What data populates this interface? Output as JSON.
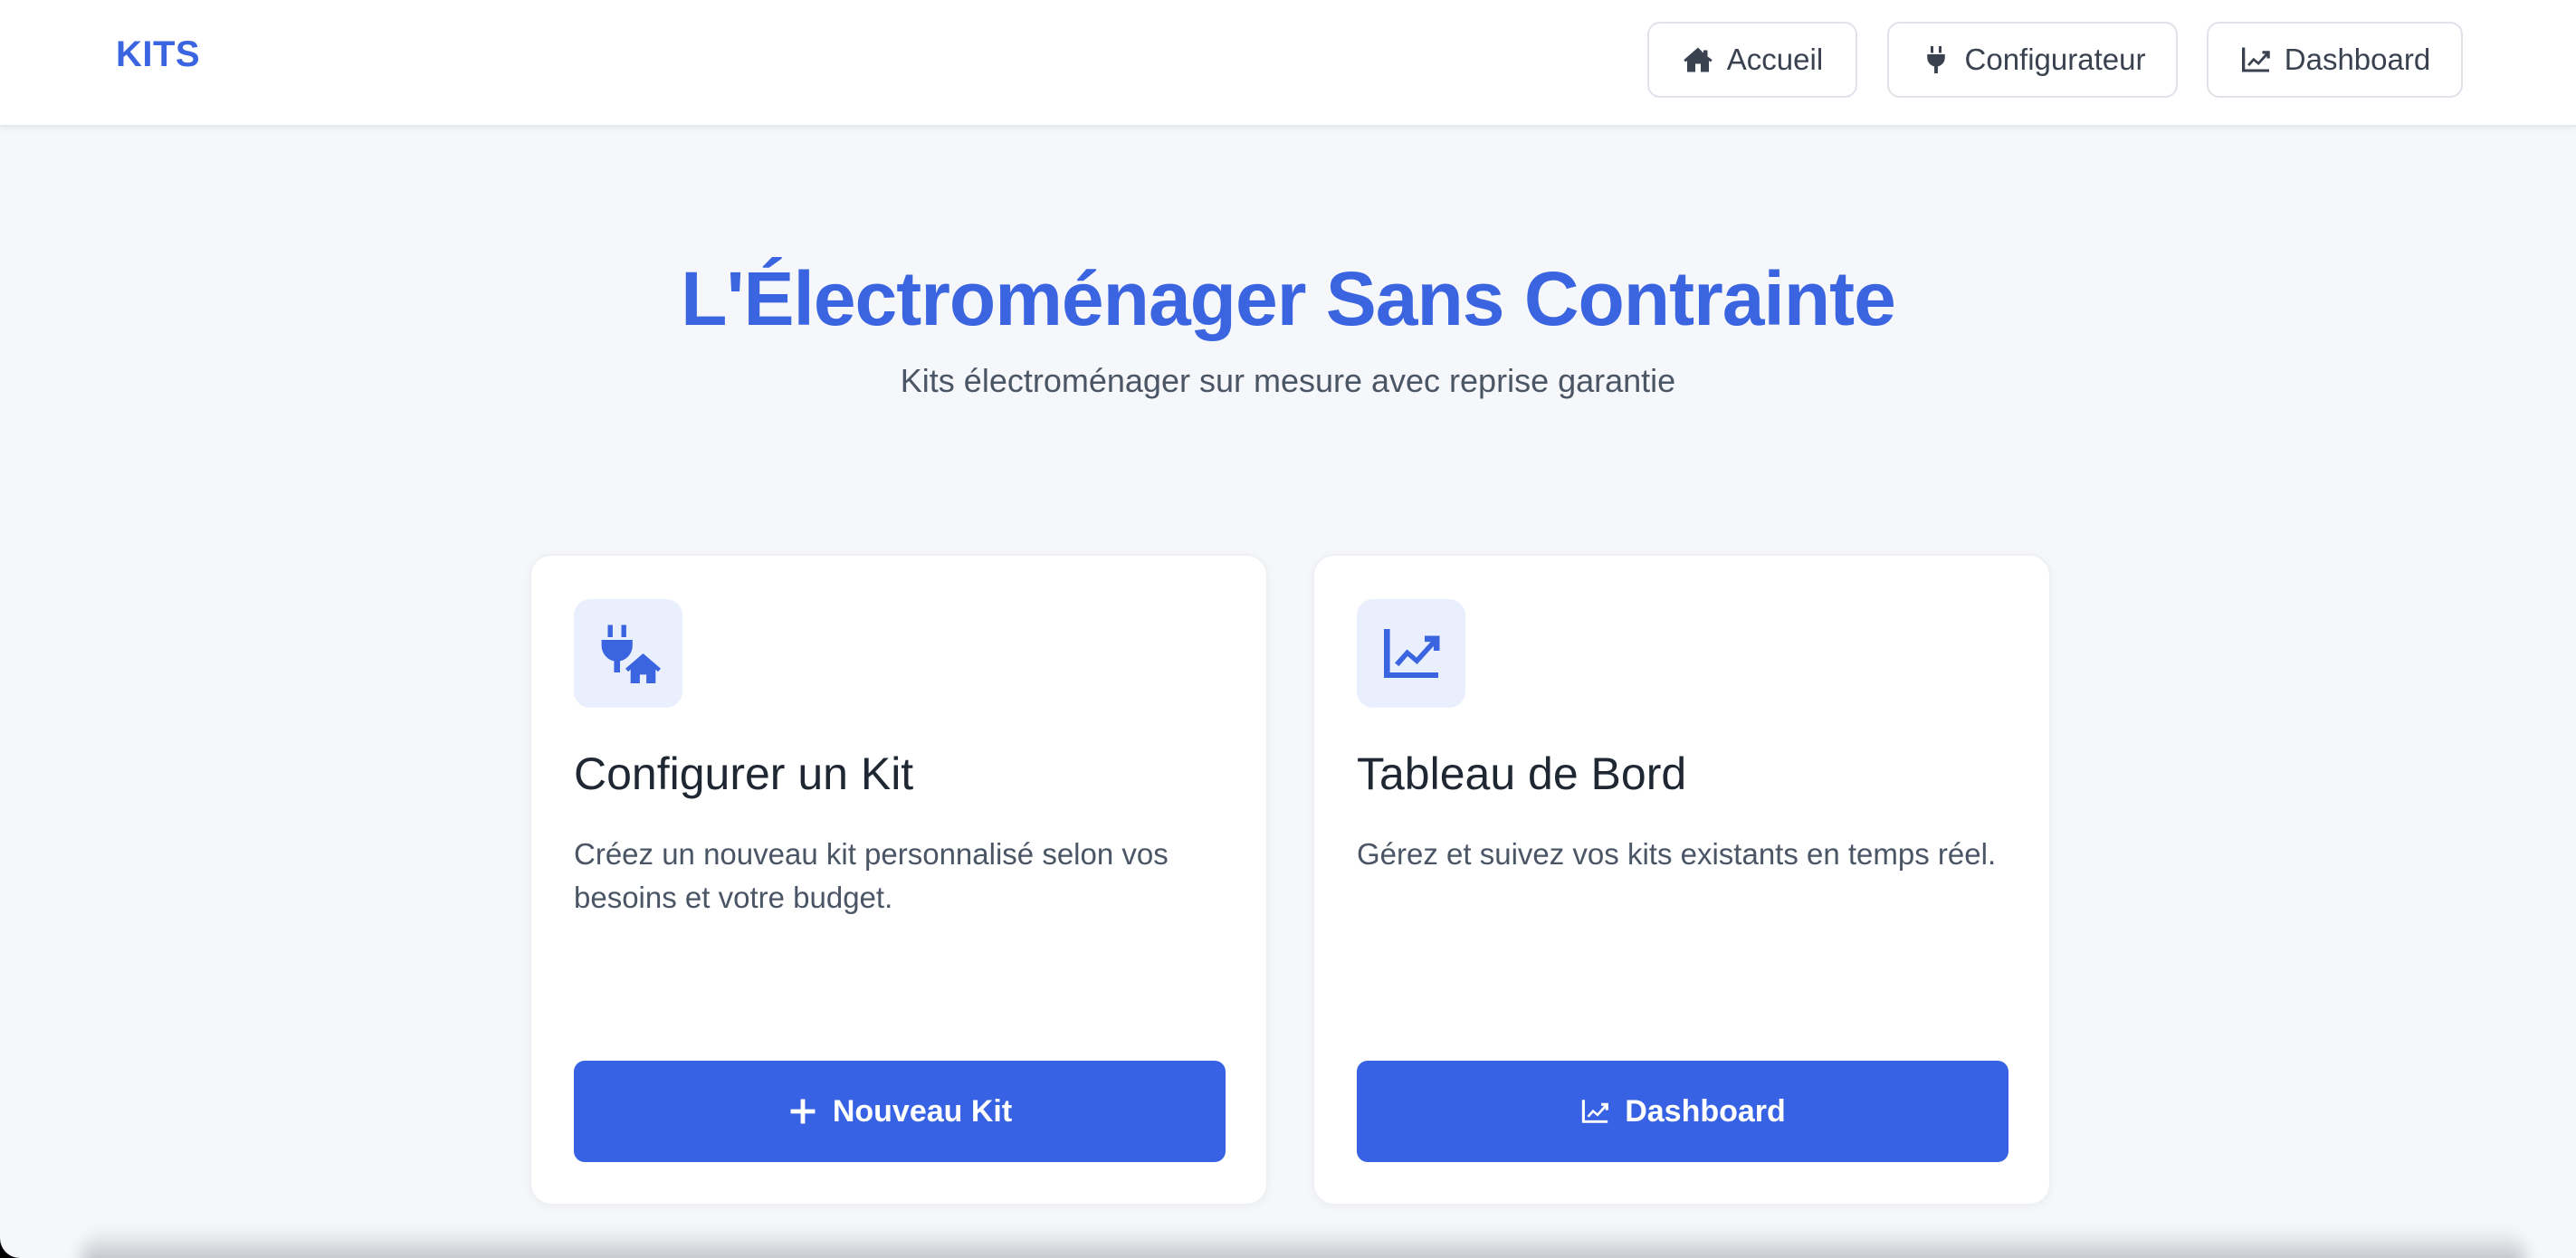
{
  "header": {
    "brand": "KITS",
    "nav": [
      {
        "label": "Accueil",
        "icon": "home-icon"
      },
      {
        "label": "Configurateur",
        "icon": "plug-icon"
      },
      {
        "label": "Dashboard",
        "icon": "chart-line-icon"
      }
    ]
  },
  "hero": {
    "title": "L'Électroménager Sans Contrainte",
    "subtitle": "Kits électroménager sur mesure avec reprise garantie"
  },
  "cards": [
    {
      "icon": "plug-home-icon",
      "title": "Configurer un Kit",
      "description": "Créez un nouveau kit personnalisé selon vos besoins et votre budget.",
      "button": {
        "label": "Nouveau Kit",
        "icon": "plus-icon"
      }
    },
    {
      "icon": "chart-line-icon",
      "title": "Tableau de Bord",
      "description": "Gérez et suivez vos kits existants en temps réel.",
      "button": {
        "label": "Dashboard",
        "icon": "chart-line-icon"
      }
    }
  ],
  "colors": {
    "accent": "#3b64e0",
    "button": "#3762e3",
    "background": "#f5f7fa",
    "icon_bg": "#e9effc"
  }
}
